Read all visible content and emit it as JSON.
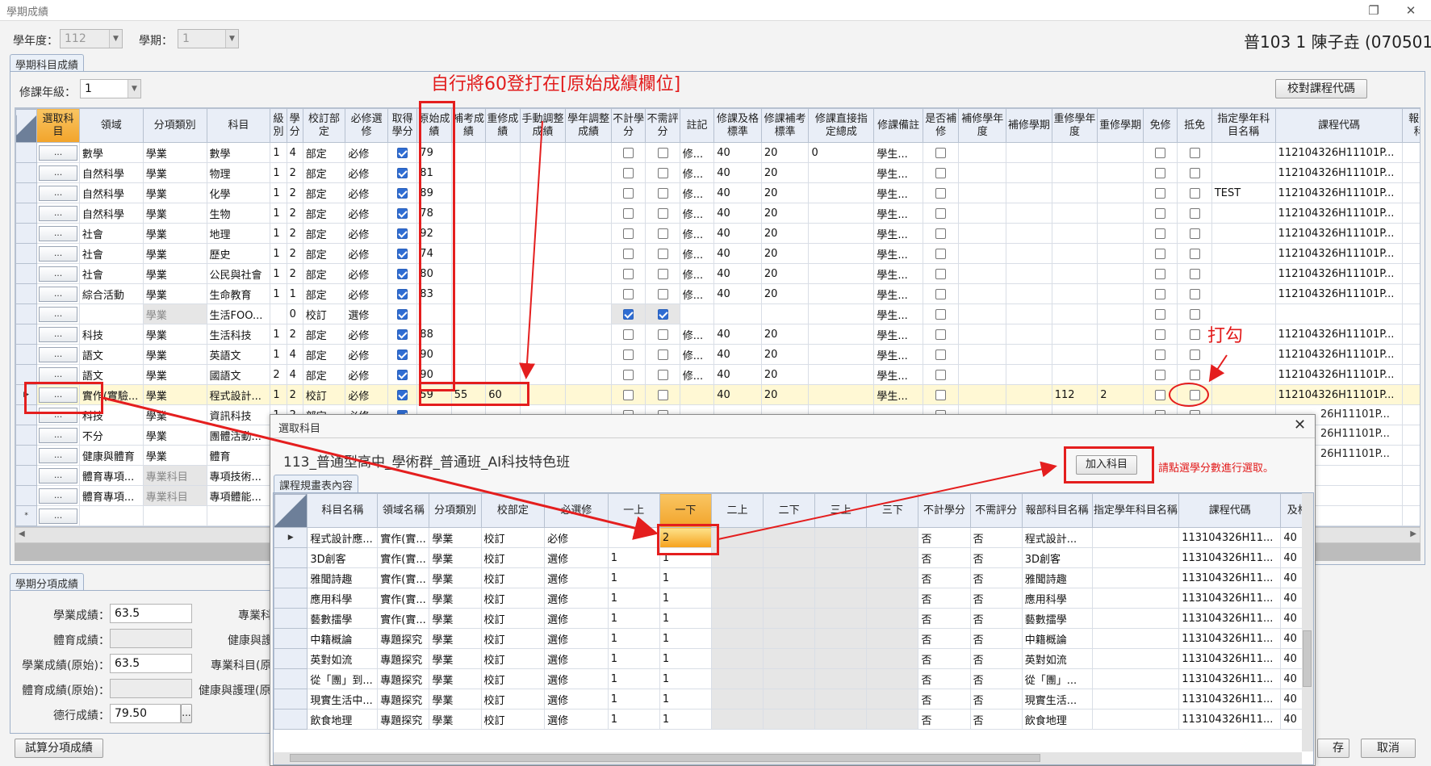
{
  "window": {
    "title": "學期成績",
    "restore_icon": "restore-icon",
    "close_icon": "close-icon"
  },
  "header": {
    "year_label": "學年度：",
    "year_value": "112",
    "term_label": "學期：",
    "term_value": "1",
    "student": "普103 1 陳子垚 (070501)"
  },
  "subjects_section": {
    "tab": "學期科目成績",
    "grade_label": "修課年級：",
    "grade_value": "1",
    "check_code_button": "校對課程代碼",
    "columns": [
      "選取科目",
      "領域",
      "分項類別",
      "科目",
      "級別",
      "學分",
      "校訂部定",
      "必修選修",
      "取得學分",
      "原始成績",
      "補考成績",
      "重修成績",
      "手動調整成績",
      "學年調整成績",
      "不計學分",
      "不需評分",
      "註記",
      "修課及格標準",
      "修課補考標準",
      "修課直接指定總成",
      "修課備註",
      "是否補修",
      "補修學年度",
      "補修學期",
      "重修學年度",
      "重修學期",
      "免修",
      "抵免",
      "指定學年科目名稱",
      "課程代碼",
      "報部科"
    ],
    "rows": [
      {
        "sel": "...",
        "domain": "數學",
        "cat": "學業",
        "subject": "數學",
        "level": "1",
        "credit": "4",
        "sch": "部定",
        "req": "必修",
        "got": true,
        "orig": "79",
        "makeup": "",
        "retake": "",
        "manual": "",
        "yearadj": "",
        "nocredit": false,
        "noscore": false,
        "note": "修...",
        "pass": "40",
        "mkpass": "20",
        "direct": "0",
        "remark": "學生...",
        "isfix": false,
        "fixyear": "",
        "fixterm": "",
        "reyear": "",
        "reterm": "",
        "exempt": false,
        "offset": false,
        "assign": "",
        "code": "112104326H11101P..."
      },
      {
        "sel": "...",
        "domain": "自然科學",
        "cat": "學業",
        "subject": "物理",
        "level": "1",
        "credit": "2",
        "sch": "部定",
        "req": "必修",
        "got": true,
        "orig": "81",
        "makeup": "",
        "retake": "",
        "manual": "",
        "yearadj": "",
        "nocredit": false,
        "noscore": false,
        "note": "修...",
        "pass": "40",
        "mkpass": "20",
        "direct": "",
        "remark": "學生...",
        "isfix": false,
        "fixyear": "",
        "fixterm": "",
        "reyear": "",
        "reterm": "",
        "exempt": false,
        "offset": false,
        "assign": "",
        "code": "112104326H11101P..."
      },
      {
        "sel": "...",
        "domain": "自然科學",
        "cat": "學業",
        "subject": "化學",
        "level": "1",
        "credit": "2",
        "sch": "部定",
        "req": "必修",
        "got": true,
        "orig": "89",
        "makeup": "",
        "retake": "",
        "manual": "",
        "yearadj": "",
        "nocredit": false,
        "noscore": false,
        "note": "修...",
        "pass": "40",
        "mkpass": "20",
        "direct": "",
        "remark": "學生...",
        "isfix": false,
        "fixyear": "",
        "fixterm": "",
        "reyear": "",
        "reterm": "",
        "exempt": false,
        "offset": false,
        "assign": "TEST",
        "code": "112104326H11101P..."
      },
      {
        "sel": "...",
        "domain": "自然科學",
        "cat": "學業",
        "subject": "生物",
        "level": "1",
        "credit": "2",
        "sch": "部定",
        "req": "必修",
        "got": true,
        "orig": "78",
        "makeup": "",
        "retake": "",
        "manual": "",
        "yearadj": "",
        "nocredit": false,
        "noscore": false,
        "note": "修...",
        "pass": "40",
        "mkpass": "20",
        "direct": "",
        "remark": "學生...",
        "isfix": false,
        "fixyear": "",
        "fixterm": "",
        "reyear": "",
        "reterm": "",
        "exempt": false,
        "offset": false,
        "assign": "",
        "code": "112104326H11101P..."
      },
      {
        "sel": "...",
        "domain": "社會",
        "cat": "學業",
        "subject": "地理",
        "level": "1",
        "credit": "2",
        "sch": "部定",
        "req": "必修",
        "got": true,
        "orig": "92",
        "makeup": "",
        "retake": "",
        "manual": "",
        "yearadj": "",
        "nocredit": false,
        "noscore": false,
        "note": "修...",
        "pass": "40",
        "mkpass": "20",
        "direct": "",
        "remark": "學生...",
        "isfix": false,
        "fixyear": "",
        "fixterm": "",
        "reyear": "",
        "reterm": "",
        "exempt": false,
        "offset": false,
        "assign": "",
        "code": "112104326H11101P..."
      },
      {
        "sel": "...",
        "domain": "社會",
        "cat": "學業",
        "subject": "歷史",
        "level": "1",
        "credit": "2",
        "sch": "部定",
        "req": "必修",
        "got": true,
        "orig": "74",
        "makeup": "",
        "retake": "",
        "manual": "",
        "yearadj": "",
        "nocredit": false,
        "noscore": false,
        "note": "修...",
        "pass": "40",
        "mkpass": "20",
        "direct": "",
        "remark": "學生...",
        "isfix": false,
        "fixyear": "",
        "fixterm": "",
        "reyear": "",
        "reterm": "",
        "exempt": false,
        "offset": false,
        "assign": "",
        "code": "112104326H11101P..."
      },
      {
        "sel": "...",
        "domain": "社會",
        "cat": "學業",
        "subject": "公民與社會",
        "level": "1",
        "credit": "2",
        "sch": "部定",
        "req": "必修",
        "got": true,
        "orig": "80",
        "makeup": "",
        "retake": "",
        "manual": "",
        "yearadj": "",
        "nocredit": false,
        "noscore": false,
        "note": "修...",
        "pass": "40",
        "mkpass": "20",
        "direct": "",
        "remark": "學生...",
        "isfix": false,
        "fixyear": "",
        "fixterm": "",
        "reyear": "",
        "reterm": "",
        "exempt": false,
        "offset": false,
        "assign": "",
        "code": "112104326H11101P..."
      },
      {
        "sel": "...",
        "domain": "綜合活動",
        "cat": "學業",
        "subject": "生命教育",
        "level": "1",
        "credit": "1",
        "sch": "部定",
        "req": "必修",
        "got": true,
        "orig": "83",
        "makeup": "",
        "retake": "",
        "manual": "",
        "yearadj": "",
        "nocredit": false,
        "noscore": false,
        "note": "修...",
        "pass": "40",
        "mkpass": "20",
        "direct": "",
        "remark": "學生...",
        "isfix": false,
        "fixyear": "",
        "fixterm": "",
        "reyear": "",
        "reterm": "",
        "exempt": false,
        "offset": false,
        "assign": "",
        "code": "112104326H11101P..."
      },
      {
        "sel": "...",
        "domain": "",
        "cat": "學業",
        "subject": "生活FOO...",
        "level": "",
        "credit": "0",
        "sch": "校訂",
        "req": "選修",
        "got": true,
        "orig": "",
        "makeup": "",
        "retake": "",
        "manual": "",
        "yearadj": "",
        "nocredit": true,
        "noscore": true,
        "note": "",
        "pass": "",
        "mkpass": "",
        "direct": "",
        "remark": "學生...",
        "isfix": false,
        "fixyear": "",
        "fixterm": "",
        "reyear": "",
        "reterm": "",
        "exempt": false,
        "offset": false,
        "assign": "",
        "code": "",
        "graycat": true
      },
      {
        "sel": "...",
        "domain": "科技",
        "cat": "學業",
        "subject": "生活科技",
        "level": "1",
        "credit": "2",
        "sch": "部定",
        "req": "必修",
        "got": true,
        "orig": "88",
        "makeup": "",
        "retake": "",
        "manual": "",
        "yearadj": "",
        "nocredit": false,
        "noscore": false,
        "note": "修...",
        "pass": "40",
        "mkpass": "20",
        "direct": "",
        "remark": "學生...",
        "isfix": false,
        "fixyear": "",
        "fixterm": "",
        "reyear": "",
        "reterm": "",
        "exempt": false,
        "offset": false,
        "assign": "",
        "code": "112104326H11101P..."
      },
      {
        "sel": "...",
        "domain": "語文",
        "cat": "學業",
        "subject": "英語文",
        "level": "1",
        "credit": "4",
        "sch": "部定",
        "req": "必修",
        "got": true,
        "orig": "90",
        "makeup": "",
        "retake": "",
        "manual": "",
        "yearadj": "",
        "nocredit": false,
        "noscore": false,
        "note": "修...",
        "pass": "40",
        "mkpass": "20",
        "direct": "",
        "remark": "學生...",
        "isfix": false,
        "fixyear": "",
        "fixterm": "",
        "reyear": "",
        "reterm": "",
        "exempt": false,
        "offset": false,
        "assign": "",
        "code": "112104326H11101P..."
      },
      {
        "sel": "...",
        "domain": "語文",
        "cat": "學業",
        "subject": "國語文",
        "level": "2",
        "credit": "4",
        "sch": "部定",
        "req": "必修",
        "got": true,
        "orig": "90",
        "makeup": "",
        "retake": "",
        "manual": "",
        "yearadj": "",
        "nocredit": false,
        "noscore": false,
        "note": "修...",
        "pass": "40",
        "mkpass": "20",
        "direct": "",
        "remark": "學生...",
        "isfix": false,
        "fixyear": "",
        "fixterm": "",
        "reyear": "",
        "reterm": "",
        "exempt": false,
        "offset": false,
        "assign": "",
        "code": "112104326H11101P..."
      },
      {
        "sel": "...",
        "domain": "實作(實驗...",
        "cat": "學業",
        "subject": "程式設計...",
        "level": "1",
        "credit": "2",
        "sch": "校訂",
        "req": "必修",
        "got": true,
        "orig": "59",
        "makeup": "55",
        "retake": "60",
        "manual": "",
        "yearadj": "",
        "nocredit": false,
        "noscore": false,
        "note": "",
        "pass": "40",
        "mkpass": "20",
        "direct": "",
        "remark": "學生...",
        "isfix": false,
        "fixyear": "",
        "fixterm": "",
        "reyear": "112",
        "reterm": "2",
        "exempt": false,
        "offset": false,
        "assign": "",
        "code": "112104326H11101P...",
        "active": true
      },
      {
        "sel": "...",
        "domain": "科技",
        "cat": "學業",
        "subject": "資訊科技",
        "level": "1",
        "credit": "2",
        "sch": "部定",
        "req": "必修",
        "got": true,
        "orig": "",
        "makeup": "",
        "retake": "",
        "manual": "",
        "yearadj": "",
        "nocredit": false,
        "noscore": false,
        "note": "",
        "pass": "",
        "mkpass": "",
        "direct": "",
        "remark": "",
        "isfix": false,
        "fixyear": "",
        "fixterm": "",
        "reyear": "",
        "reterm": "",
        "exempt": false,
        "offset": false,
        "assign": "",
        "code": ""
      },
      {
        "sel": "...",
        "domain": "不分",
        "cat": "學業",
        "subject": "團體活動...",
        "level": "",
        "credit": "",
        "sch": "",
        "req": "",
        "got": false,
        "orig": "",
        "makeup": "",
        "retake": "",
        "manual": "",
        "yearadj": "",
        "nocredit": false,
        "noscore": false,
        "note": "",
        "pass": "",
        "mkpass": "",
        "direct": "",
        "remark": "",
        "isfix": false,
        "fixyear": "",
        "fixterm": "",
        "reyear": "",
        "reterm": "",
        "exempt": false,
        "offset": false,
        "assign": "",
        "code": ""
      },
      {
        "sel": "...",
        "domain": "健康與體育",
        "cat": "學業",
        "subject": "體育",
        "level": "",
        "credit": "",
        "sch": "",
        "req": "",
        "got": false,
        "orig": "",
        "makeup": "",
        "retake": "",
        "manual": "",
        "yearadj": "",
        "nocredit": false,
        "noscore": false,
        "note": "",
        "pass": "",
        "mkpass": "",
        "direct": "",
        "remark": "",
        "isfix": false,
        "fixyear": "",
        "fixterm": "",
        "reyear": "",
        "reterm": "",
        "exempt": false,
        "offset": false,
        "assign": "",
        "code": ""
      },
      {
        "sel": "...",
        "domain": "體育專項...",
        "cat": "專業科目",
        "subject": "專項技術...",
        "level": "",
        "credit": "",
        "sch": "",
        "req": "",
        "got": false,
        "orig": "",
        "makeup": "",
        "retake": "",
        "manual": "",
        "yearadj": "",
        "nocredit": false,
        "noscore": false,
        "note": "",
        "pass": "",
        "mkpass": "",
        "direct": "",
        "remark": "",
        "isfix": false,
        "fixyear": "",
        "fixterm": "",
        "reyear": "",
        "reterm": "",
        "exempt": false,
        "offset": false,
        "assign": "",
        "code": "",
        "graycat": true
      },
      {
        "sel": "...",
        "domain": "體育專項...",
        "cat": "專業科目",
        "subject": "專項體能...",
        "level": "",
        "credit": "",
        "sch": "",
        "req": "",
        "got": false,
        "orig": "",
        "makeup": "",
        "retake": "",
        "manual": "",
        "yearadj": "",
        "nocredit": false,
        "noscore": false,
        "note": "",
        "pass": "",
        "mkpass": "",
        "direct": "",
        "remark": "",
        "isfix": false,
        "fixyear": "",
        "fixterm": "",
        "reyear": "",
        "reterm": "",
        "exempt": false,
        "offset": false,
        "assign": "",
        "code": "",
        "graycat": true
      }
    ],
    "new_row_button": "...",
    "partial_codes": [
      "26H11101P...",
      "26H11101P...",
      "26H11101P..."
    ]
  },
  "category_section": {
    "tab": "學期分項成績",
    "fields": [
      {
        "label": "學業成績：",
        "value": "63.5",
        "disabled": false
      },
      {
        "label": "體育成績：",
        "value": "",
        "disabled": true
      },
      {
        "label": "學業成績(原始)：",
        "value": "63.5",
        "disabled": false
      },
      {
        "label": "體育成績(原始)：",
        "value": "",
        "disabled": true
      },
      {
        "label": "德行成績：",
        "value": "79.50",
        "disabled": false
      }
    ],
    "right_labels": [
      "專業科",
      "健康與護",
      "專業科目(原",
      "健康與護理(原始"
    ],
    "more_button": "...",
    "calc_button": "試算分項成績",
    "save_button_partial": "存",
    "cancel_button": "取消"
  },
  "dialog": {
    "title": "選取科目",
    "close_icon": "close-icon",
    "program": "113_普通型高中_學術群_普通班_AI科技特色班",
    "add_button": "加入科目",
    "hint": "請點選學分數進行選取。",
    "tab": "課程規畫表內容",
    "columns": [
      "科目名稱",
      "領域名稱",
      "分項類別",
      "校部定",
      "必選修",
      "一上",
      "一下",
      "二上",
      "二下",
      "三上",
      "三下",
      "不計學分",
      "不需評分",
      "報部科目名稱",
      "指定學年科目名稱",
      "課程代碼",
      "及格"
    ],
    "rows": [
      {
        "name": "程式設計應...",
        "domain": "實作(實...",
        "cat": "學業",
        "sch": "校訂",
        "req": "必修",
        "s1": "",
        "s2": "2",
        "nocredit": "否",
        "noscore": "否",
        "report": "程式設計...",
        "assign": "",
        "code": "113104326H11...",
        "pass": "40",
        "active": true
      },
      {
        "name": "3D創客",
        "domain": "實作(實...",
        "cat": "學業",
        "sch": "校訂",
        "req": "選修",
        "s1": "1",
        "s2": "1",
        "nocredit": "否",
        "noscore": "否",
        "report": "3D創客",
        "assign": "",
        "code": "113104326H11...",
        "pass": "40"
      },
      {
        "name": "雅聞詩趣",
        "domain": "實作(實...",
        "cat": "學業",
        "sch": "校訂",
        "req": "選修",
        "s1": "1",
        "s2": "1",
        "nocredit": "否",
        "noscore": "否",
        "report": "雅聞詩趣",
        "assign": "",
        "code": "113104326H11...",
        "pass": "40"
      },
      {
        "name": "應用科學",
        "domain": "實作(實...",
        "cat": "學業",
        "sch": "校訂",
        "req": "選修",
        "s1": "1",
        "s2": "1",
        "nocredit": "否",
        "noscore": "否",
        "report": "應用科學",
        "assign": "",
        "code": "113104326H11...",
        "pass": "40"
      },
      {
        "name": "藝數擂學",
        "domain": "實作(實...",
        "cat": "學業",
        "sch": "校訂",
        "req": "選修",
        "s1": "1",
        "s2": "1",
        "nocredit": "否",
        "noscore": "否",
        "report": "藝數擂學",
        "assign": "",
        "code": "113104326H11...",
        "pass": "40"
      },
      {
        "name": "中籍概論",
        "domain": "專題探究",
        "cat": "學業",
        "sch": "校訂",
        "req": "選修",
        "s1": "1",
        "s2": "1",
        "nocredit": "否",
        "noscore": "否",
        "report": "中籍概論",
        "assign": "",
        "code": "113104326H11...",
        "pass": "40"
      },
      {
        "name": "英對如流",
        "domain": "專題探究",
        "cat": "學業",
        "sch": "校訂",
        "req": "選修",
        "s1": "1",
        "s2": "1",
        "nocredit": "否",
        "noscore": "否",
        "report": "英對如流",
        "assign": "",
        "code": "113104326H11...",
        "pass": "40"
      },
      {
        "name": "從「團」到...",
        "domain": "專題探究",
        "cat": "學業",
        "sch": "校訂",
        "req": "選修",
        "s1": "1",
        "s2": "1",
        "nocredit": "否",
        "noscore": "否",
        "report": "從「團」...",
        "assign": "",
        "code": "113104326H11...",
        "pass": "40"
      },
      {
        "name": "現實生活中...",
        "domain": "專題探究",
        "cat": "學業",
        "sch": "校訂",
        "req": "選修",
        "s1": "1",
        "s2": "1",
        "nocredit": "否",
        "noscore": "否",
        "report": "現實生活...",
        "assign": "",
        "code": "113104326H11...",
        "pass": "40"
      },
      {
        "name": "飲食地理",
        "domain": "專題探究",
        "cat": "學業",
        "sch": "校訂",
        "req": "選修",
        "s1": "1",
        "s2": "1",
        "nocredit": "否",
        "noscore": "否",
        "report": "飲食地理",
        "assign": "",
        "code": "113104326H11...",
        "pass": "40"
      }
    ]
  },
  "annotations": {
    "top": "自行將60登打在[原始成績欄位]",
    "check": "打勾",
    "color": "#e21b1b"
  }
}
